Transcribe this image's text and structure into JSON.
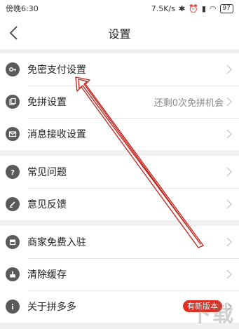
{
  "status_bar": {
    "time": "傍晚6:30",
    "speed": "7.5K/s",
    "battery": "97"
  },
  "navbar": {
    "title": "设置"
  },
  "groups": [
    {
      "items": [
        {
          "label": "免密支付设置",
          "icon": "key-icon"
        },
        {
          "label": "免拼设置",
          "icon": "coupon-icon",
          "hint": "还剩0次免拼机会"
        },
        {
          "label": "消息接收设置",
          "icon": "mail-icon"
        }
      ]
    },
    {
      "items": [
        {
          "label": "常见问题",
          "icon": "question-icon"
        },
        {
          "label": "意见反馈",
          "icon": "pencil-icon"
        }
      ]
    },
    {
      "items": [
        {
          "label": "商家免费入驻",
          "icon": "store-icon"
        },
        {
          "label": "清除缓存",
          "icon": "broom-icon"
        },
        {
          "label": "关于拼多多",
          "icon": "info-icon",
          "badge": "有新版本"
        }
      ]
    }
  ],
  "colors": {
    "accent": "#e02e24",
    "annotation_arrow": "#c0221b"
  },
  "watermark": "下载"
}
